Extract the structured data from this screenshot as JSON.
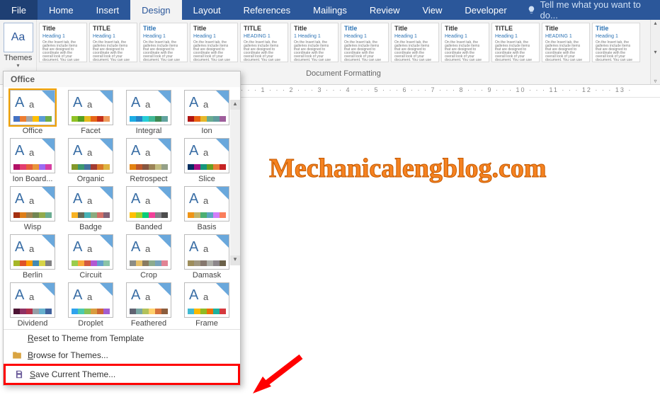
{
  "tabs": {
    "file": "File",
    "items": [
      "Home",
      "Insert",
      "Design",
      "Layout",
      "References",
      "Mailings",
      "Review",
      "View",
      "Developer"
    ],
    "active": "Design",
    "tellme": "Tell me what you want to do..."
  },
  "themes_button": {
    "label": "Themes",
    "glyph": "Aa"
  },
  "doc_formatting_label": "Document Formatting",
  "style_sets": [
    {
      "title": "Title",
      "h1": "Heading 1",
      "blue": false,
      "caps": false
    },
    {
      "title": "TITLE",
      "h1": "Heading 1",
      "blue": false,
      "caps": true
    },
    {
      "title": "Title",
      "h1": "Heading 1",
      "blue": true,
      "caps": false
    },
    {
      "title": "Title",
      "h1": "Heading 1",
      "blue": false,
      "caps": false
    },
    {
      "title": "TITLE",
      "h1": "HEADING 1",
      "blue": false,
      "caps": true
    },
    {
      "title": "Title",
      "h1": "1  Heading 1",
      "blue": false,
      "caps": false
    },
    {
      "title": "Title",
      "h1": "Heading 1",
      "blue": true,
      "caps": false
    },
    {
      "title": "Title",
      "h1": "Heading 1",
      "blue": false,
      "caps": false
    },
    {
      "title": "Title",
      "h1": "Heading 1",
      "blue": false,
      "caps": false
    },
    {
      "title": "TITLE",
      "h1": "Heading 1",
      "blue": false,
      "caps": true
    },
    {
      "title": "Title",
      "h1": "HEADING 1",
      "blue": false,
      "caps": false
    },
    {
      "title": "Title",
      "h1": "Heading 1",
      "blue": true,
      "caps": false
    }
  ],
  "ruler_text": "  ·  ·  ·  1  ·  ·  ·  2  ·  ·  ·  3  ·  ·  ·  4  ·  ·  ·  5  ·  ·  ·  6  ·  ·  ·  7  ·  ·  ·  8  ·  ·  ·  9  ·  ·  ·  10  ·  ·  ·  11  ·  ·  ·  12  ·  ·  ·  13  ·",
  "watermark": "Mechanicalengblog.com",
  "panel": {
    "header": "Office",
    "themes": [
      {
        "name": "Office",
        "selected": true,
        "colors": [
          "#4472c4",
          "#ed7d31",
          "#a5a5a5",
          "#ffc000",
          "#5b9bd5",
          "#70ad47"
        ]
      },
      {
        "name": "Facet",
        "colors": [
          "#90c226",
          "#54a021",
          "#e6b91e",
          "#e76618",
          "#c42f1a",
          "#ef9b5b"
        ]
      },
      {
        "name": "Integral",
        "colors": [
          "#1cade4",
          "#2683c6",
          "#27ced7",
          "#42ba97",
          "#3e8853",
          "#62a39f"
        ]
      },
      {
        "name": "Ion",
        "colors": [
          "#b01513",
          "#ea6312",
          "#e6b729",
          "#6aac90",
          "#5f9c9d",
          "#9e5e9b"
        ]
      },
      {
        "name": "Ion Board...",
        "colors": [
          "#b31166",
          "#e33d6f",
          "#e45f3c",
          "#e9943a",
          "#9b6bf2",
          "#d63fa2"
        ]
      },
      {
        "name": "Organic",
        "colors": [
          "#83992a",
          "#3c9770",
          "#44709d",
          "#a23c33",
          "#d97828",
          "#deb340"
        ]
      },
      {
        "name": "Retrospect",
        "colors": [
          "#e48312",
          "#bd582c",
          "#865640",
          "#9b8357",
          "#c2bc80",
          "#94a088"
        ]
      },
      {
        "name": "Slice",
        "colors": [
          "#052f61",
          "#a50e82",
          "#14967c",
          "#6a9e1f",
          "#e87d37",
          "#c62324"
        ]
      },
      {
        "name": "Wisp",
        "colors": [
          "#a53010",
          "#de7e18",
          "#9f8351",
          "#728653",
          "#92aa4c",
          "#6aac91"
        ]
      },
      {
        "name": "Badge",
        "colors": [
          "#f8b323",
          "#656a59",
          "#46b2b5",
          "#8caa7e",
          "#d36f68",
          "#826276"
        ]
      },
      {
        "name": "Banded",
        "colors": [
          "#ffc000",
          "#a5d028",
          "#08cc78",
          "#f24099",
          "#828288",
          "#4d4d4d"
        ]
      },
      {
        "name": "Basis",
        "colors": [
          "#f09415",
          "#c1b56b",
          "#4baf73",
          "#5aa6c0",
          "#d17df9",
          "#fa7e5c"
        ]
      },
      {
        "name": "Berlin",
        "colors": [
          "#a6b727",
          "#df5327",
          "#fe9e00",
          "#418ab3",
          "#d7d447",
          "#818183"
        ]
      },
      {
        "name": "Circuit",
        "colors": [
          "#9acd4c",
          "#faa93a",
          "#d35940",
          "#b258d3",
          "#63a0cc",
          "#8ac4a7"
        ]
      },
      {
        "name": "Crop",
        "colors": [
          "#8c8d86",
          "#e6c069",
          "#897b61",
          "#8dab8e",
          "#77a2bb",
          "#e28394"
        ]
      },
      {
        "name": "Damask",
        "colors": [
          "#9e8e5c",
          "#a09781",
          "#85776d",
          "#aeafa9",
          "#8d878b",
          "#6b6149"
        ]
      },
      {
        "name": "Dividend",
        "colors": [
          "#4d1434",
          "#903163",
          "#b2324b",
          "#969fa7",
          "#66b1ce",
          "#40619d"
        ]
      },
      {
        "name": "Droplet",
        "colors": [
          "#2fa3ee",
          "#4bcaad",
          "#86c157",
          "#d99c3f",
          "#ce6633",
          "#a35dd1"
        ]
      },
      {
        "name": "Feathered",
        "colors": [
          "#606372",
          "#79a8a4",
          "#b2c25b",
          "#ffd06b",
          "#d5713c",
          "#8b5d3d"
        ]
      },
      {
        "name": "Frame",
        "colors": [
          "#40bad2",
          "#fab900",
          "#90bb23",
          "#ee7008",
          "#1ab39f",
          "#d5393d"
        ]
      }
    ],
    "reset": "Reset to Theme from Template",
    "browse": "Browse for Themes...",
    "save": "Save Current Theme..."
  }
}
